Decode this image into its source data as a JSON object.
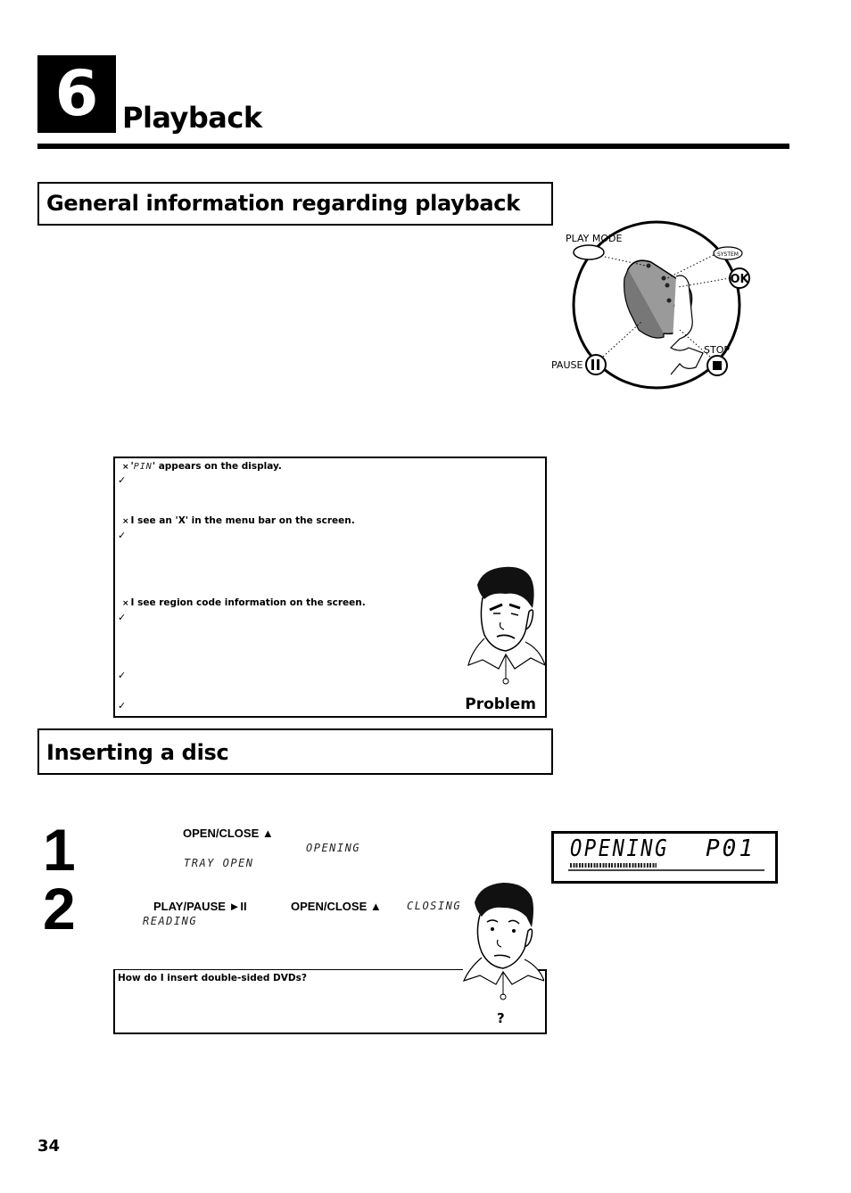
{
  "chapter": {
    "number": "6",
    "title": "Playback"
  },
  "sections": {
    "general": {
      "title": "General information regarding playback"
    },
    "inserting": {
      "title": "Inserting a disc"
    }
  },
  "remote_illustration": {
    "labels": {
      "play_mode": "PLAY MODE",
      "system": "SYSTEM",
      "ok": "OK",
      "stop": "STOP",
      "pause": "PAUSE"
    }
  },
  "problem_box": {
    "items": [
      {
        "marker": "×",
        "lcd": "PIN",
        "prefix": "'",
        "suffix": "' appears on the display."
      },
      {
        "marker": "×",
        "text": "I see an 'X' in the menu bar on the screen."
      },
      {
        "marker": "×",
        "text": "I see region code information on the screen."
      }
    ],
    "checkmark": "✓",
    "label": "Problem"
  },
  "steps": [
    {
      "number": "1",
      "button": "OPEN/CLOSE ▲",
      "display_1": "OPENING",
      "display_2": "TRAY OPEN"
    },
    {
      "number": "2",
      "button_1": "PLAY/PAUSE ►II",
      "button_2": "OPEN/CLOSE ▲",
      "display_1": "CLOSING",
      "display_2": "READING"
    }
  ],
  "lcd_display": {
    "text": "OPENING",
    "track": "P01"
  },
  "question_box": {
    "question": "How do I insert double-sided DVDs?",
    "label": "?"
  },
  "page": {
    "number": "34"
  }
}
